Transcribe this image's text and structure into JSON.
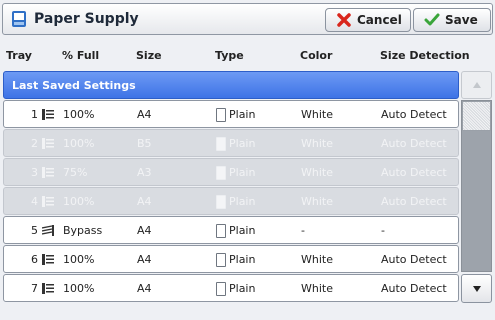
{
  "header": {
    "title": "Paper Supply",
    "cancel_label": "Cancel",
    "save_label": "Save"
  },
  "columns": {
    "tray": "Tray",
    "full": "% Full",
    "size": "Size",
    "type": "Type",
    "color": "Color",
    "detection": "Size Detection"
  },
  "group_label": "Last Saved Settings",
  "rows": [
    {
      "tray": "1",
      "full": "100%",
      "size": "A4",
      "type": "Plain",
      "color": "White",
      "detection": "Auto Detect",
      "enabled": true,
      "icon": "tray-icon"
    },
    {
      "tray": "2",
      "full": "100%",
      "size": "B5",
      "type": "Plain",
      "color": "White",
      "detection": "Auto Detect",
      "enabled": false,
      "icon": "tray-icon"
    },
    {
      "tray": "3",
      "full": "75%",
      "size": "A3",
      "type": "Plain",
      "color": "White",
      "detection": "Auto Detect",
      "enabled": false,
      "icon": "tray-icon"
    },
    {
      "tray": "4",
      "full": "100%",
      "size": "A4",
      "type": "Plain",
      "color": "White",
      "detection": "Auto Detect",
      "enabled": false,
      "icon": "tray-icon"
    },
    {
      "tray": "5",
      "full": "Bypass",
      "size": "A4",
      "type": "Plain",
      "color": "-",
      "detection": "-",
      "enabled": true,
      "icon": "bypass-tray-icon"
    },
    {
      "tray": "6",
      "full": "100%",
      "size": "A4",
      "type": "Plain",
      "color": "White",
      "detection": "Auto Detect",
      "enabled": true,
      "icon": "tray-icon"
    },
    {
      "tray": "7",
      "full": "100%",
      "size": "A4",
      "type": "Plain",
      "color": "White",
      "detection": "Auto Detect",
      "enabled": true,
      "icon": "tray-icon"
    }
  ],
  "colors": {
    "selection_blue": "#3e73e6",
    "cancel_icon_red": "#d9261c",
    "save_icon_green": "#3aa53a"
  }
}
